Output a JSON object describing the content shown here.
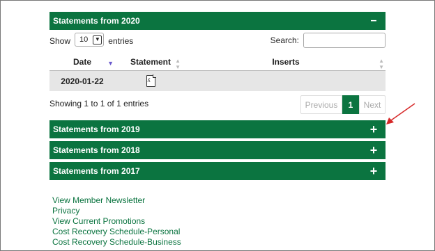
{
  "panels": {
    "y2020": {
      "title": "Statements from 2020",
      "toggle": "–"
    },
    "y2019": {
      "title": "Statements from 2019",
      "toggle": "+"
    },
    "y2018": {
      "title": "Statements from 2018",
      "toggle": "+"
    },
    "y2017": {
      "title": "Statements from 2017",
      "toggle": "+"
    }
  },
  "controls": {
    "show_label": "Show",
    "entries_value": "10",
    "entries_label": "entries",
    "search_label": "Search:"
  },
  "table": {
    "headers": {
      "date": "Date",
      "statement": "Statement",
      "inserts": "Inserts"
    },
    "rows": [
      {
        "date": "2020-01-22",
        "statement_icon": "pdf-icon",
        "inserts": ""
      }
    ]
  },
  "info": "Showing 1 to 1 of 1 entries",
  "pager": {
    "previous": "Previous",
    "current": "1",
    "next": "Next"
  },
  "links": [
    "View Member Newsletter",
    "Privacy",
    "View Current Promotions",
    "Cost Recovery Schedule-Personal",
    "Cost Recovery Schedule-Business"
  ],
  "colors": {
    "brand_green": "#0b7440",
    "annotation_arrow": "#d62828",
    "row_bg": "#e6e6e6"
  }
}
